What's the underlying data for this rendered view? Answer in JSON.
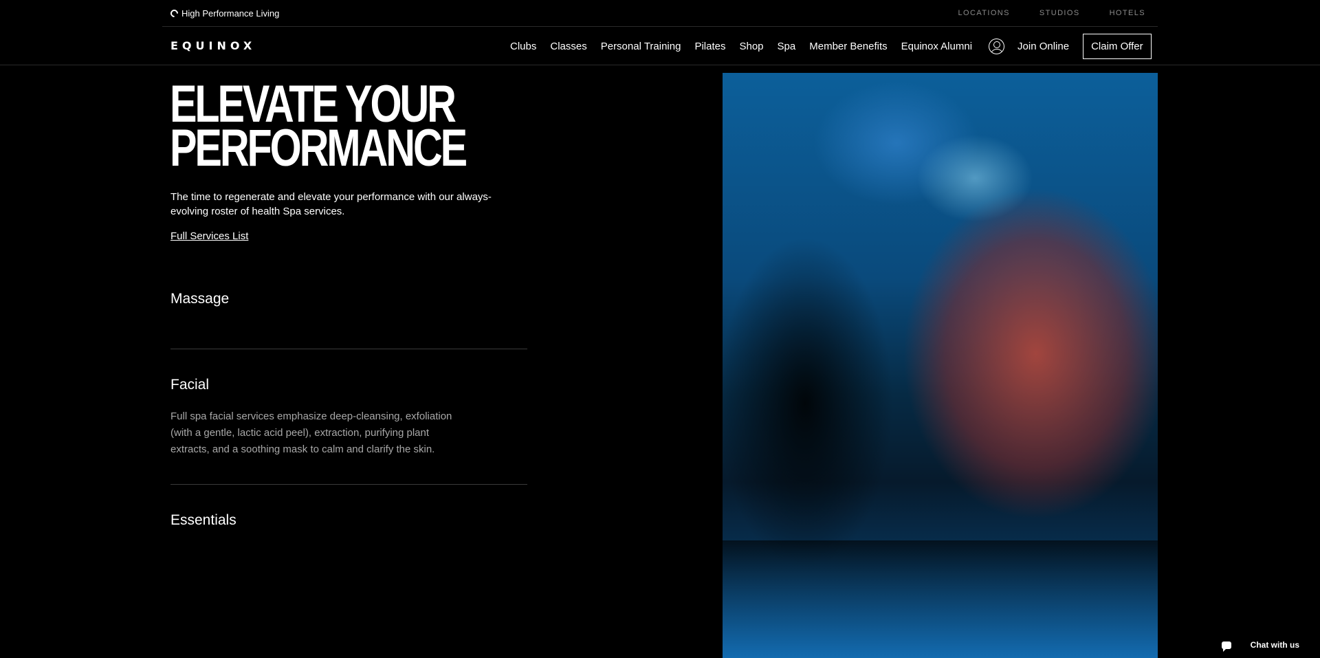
{
  "utility": {
    "tagline": "High Performance Living",
    "links": [
      "LOCATIONS",
      "STUDIOS",
      "HOTELS"
    ]
  },
  "nav": {
    "logo": "EQUINOX",
    "items": [
      "Clubs",
      "Classes",
      "Personal Training",
      "Pilates",
      "Shop",
      "Spa",
      "Member Benefits",
      "Equinox Alumni"
    ],
    "join_label": "Join Online",
    "claim_label": "Claim Offer"
  },
  "hero": {
    "title": "ELEVATE YOUR\nPERFORMANCE",
    "description": "The time to regenerate and elevate your performance with our always-evolving roster of health Spa services.",
    "link_label": "Full Services List"
  },
  "services": [
    {
      "title": "Massage",
      "body": ""
    },
    {
      "title": "Facial",
      "body": "Full spa facial services emphasize deep-cleansing, exfoliation (with a gentle, lactic acid peel), extraction, purifying plant extracts, and a soothing mask to calm and clarify the skin."
    },
    {
      "title": "Essentials",
      "body": ""
    }
  ],
  "chat": {
    "label": "Chat with us"
  }
}
